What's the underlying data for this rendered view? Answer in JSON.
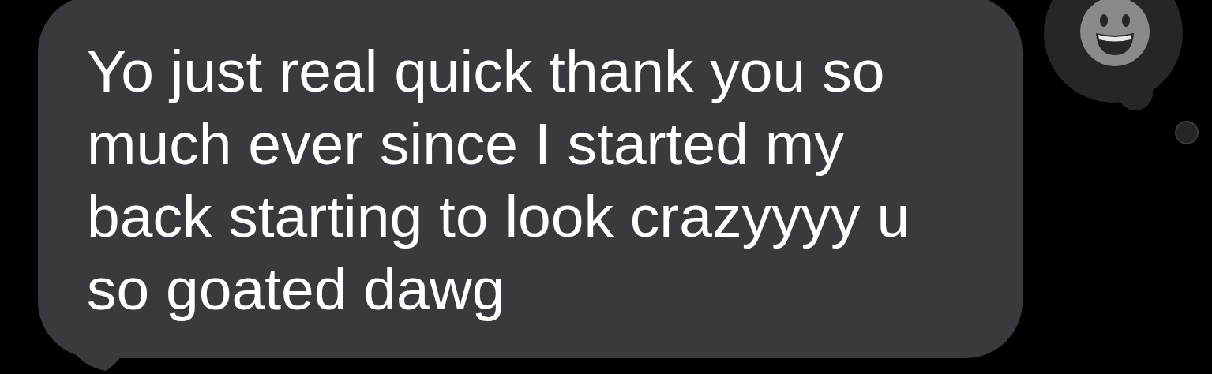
{
  "message": {
    "lines": [
      "Yo just real quick thank you so",
      "much ever since I started my",
      "back starting to look crazyyyy u",
      "so goated dawg"
    ]
  }
}
